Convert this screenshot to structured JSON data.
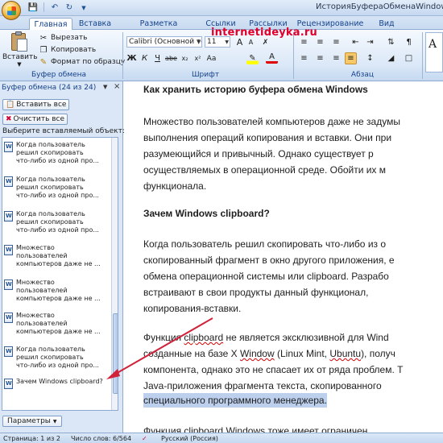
{
  "window": {
    "title": "ИсторияБуфераОбменаWindows.do"
  },
  "quick_access": {
    "icons": [
      "save-icon",
      "undo-icon",
      "redo-icon"
    ]
  },
  "tabs": [
    {
      "label": "Главная",
      "active": true
    },
    {
      "label": "Вставка"
    },
    {
      "label": "Разметка страницы"
    },
    {
      "label": "Ссылки"
    },
    {
      "label": "Рассылки"
    },
    {
      "label": "Рецензирование"
    },
    {
      "label": "Вид"
    }
  ],
  "ribbon": {
    "clipboard": {
      "paste_label": "Вставить",
      "cut_label": "Вырезать",
      "copy_label": "Копировать",
      "format_painter_label": "Формат по образцу",
      "group_label": "Буфер обмена"
    },
    "font": {
      "font_name": "Calibri (Основной те",
      "font_size": "11",
      "group_label": "Шрифт"
    },
    "paragraph": {
      "group_label": "Абзац"
    },
    "watermark": "internetideyka.ru",
    "styles_preview": "A"
  },
  "clipboard_pane": {
    "title": "Буфер обмена (24 из 24)",
    "paste_all": "Вставить все",
    "clear_all": "Очистить все",
    "hint": "Выберите вставляемый объект:",
    "items": [
      "Когда пользователь\nрешил скопировать\nчто-либо из одной про...",
      "Когда пользователь\nрешил скопировать\nчто-либо из одной про...",
      "Когда пользователь\nрешил скопировать\nчто-либо из одной про...",
      "Множество\nпользователей\nкомпьютеров даже не ...",
      "Множество\nпользователей\nкомпьютеров даже не ...",
      "Множество\nпользователей\nкомпьютеров даже не ...",
      "Когда пользователь\nрешил скопировать\nчто-либо из одной про...",
      "Зачем Windows clipboard?"
    ],
    "params": "Параметры"
  },
  "document": {
    "heading1": "Как хранить историю буфера обмена Windows",
    "p1": [
      "Множество пользователей компьютеров даже не задумы",
      "выполнения операций копирования и вставки. Они при",
      "разумеющийся и привычный. Однако существует р",
      "осуществляемых в операционной среде. Обойти их м",
      "функционала."
    ],
    "heading2": "Зачем Windows clipboard?",
    "p2": [
      "Когда пользователь решил скопировать что-либо из о",
      "скопированный фрагмент в окно другого приложения, е",
      "обмена операционной системы или clipboard. Разрабо",
      "встраивают в свои продукты данный функционал,",
      "копирования-вставки."
    ],
    "p3": {
      "l1a": "Функция ",
      "l1b": "clipboard",
      "l1c": " не является эксклюзивной для ",
      "l1d": "Wind",
      "l2a": "созданные на базе X ",
      "l2b": "Window",
      "l2c": " (Linux Mint, ",
      "l2d": "Ubuntu",
      "l2e": "), получ",
      "l3": "компонента, однако это не спасает их от ряда проблем. Т",
      "l4": "Java-приложения фрагмента текста, скопированного",
      "l5": "специального программного менеджера."
    },
    "p4": "Функция  clipboard  Windows  тоже  имеет  ограничен"
  },
  "statusbar": {
    "page": "Страница: 1 из 2",
    "words": "Число слов: 6/564",
    "language": "Русский (Россия)"
  },
  "colors": {
    "annotation_arrow": "#d0223a",
    "watermark": "#e0002b",
    "selection": "#bcd0ee"
  }
}
